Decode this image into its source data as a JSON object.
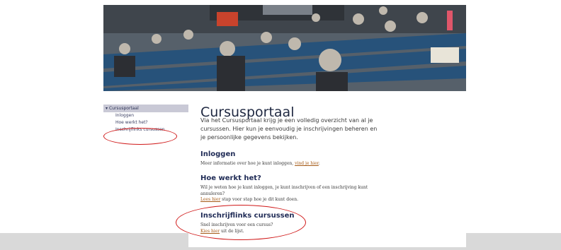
{
  "sidebar": {
    "header": "Cursusportaal",
    "items": [
      {
        "label": "Inloggen"
      },
      {
        "label": "Hoe werkt het?"
      },
      {
        "label": "Inschrijflinks cursussen"
      }
    ]
  },
  "page": {
    "title": "Cursusportaal",
    "intro": "Via het Cursusportaal krijg je een volledig overzicht van al je cursussen. Hier kun je eenvoudig je inschrijvingen beheren en je persoonlijke gegevens bekijken."
  },
  "sections": [
    {
      "heading": "Inloggen",
      "text_before": "Meer informatie over hoe je kunt inloggen, ",
      "link": "vind je hier",
      "text_after": "."
    },
    {
      "heading": "Hoe werkt het?",
      "text": "Wil je weten hoe je kunt inloggen, je kunt inschrijven of een inschrijving kunt annuleren?",
      "link": "Lees hier",
      "text_after": " stap voor stap hoe je dit kunt doen."
    },
    {
      "heading": "Inschrijflinks cursussen",
      "text": "Snel inschrijven voor een cursus?",
      "link": "Kies hier",
      "text_after": " uit de lijst."
    }
  ],
  "icons": {
    "document": "document-icon"
  },
  "colors": {
    "annotation": "#d01818",
    "link": "#a55a16",
    "heading": "#1e2a55"
  }
}
